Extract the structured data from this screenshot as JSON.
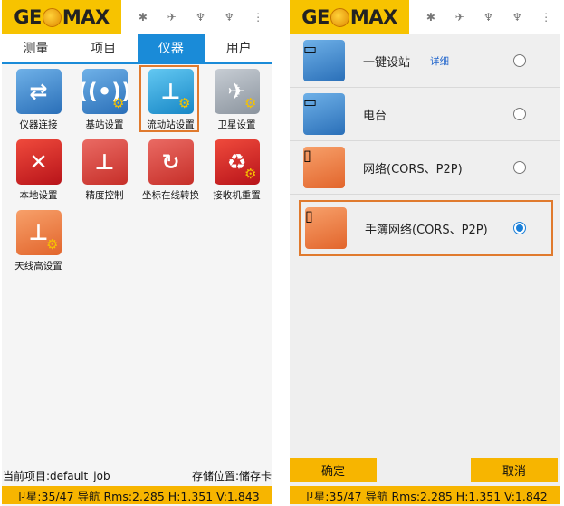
{
  "brand": {
    "logo_text_1": "GE",
    "logo_text_2": "MAX"
  },
  "status_icons": [
    "bluetooth-icon",
    "satellite-icon",
    "rover-antenna-icon",
    "radio-antenna-icon",
    "more-menu-icon"
  ],
  "left": {
    "tabs": [
      {
        "label": "测量",
        "active": false
      },
      {
        "label": "项目",
        "active": false
      },
      {
        "label": "仪器",
        "active": true
      },
      {
        "label": "用户",
        "active": false
      }
    ],
    "grid": [
      {
        "label": "仪器连接",
        "icon": "instrument-connect-icon"
      },
      {
        "label": "基站设置",
        "icon": "base-station-icon"
      },
      {
        "label": "流动站设置",
        "icon": "rover-settings-icon",
        "selected": true
      },
      {
        "label": "卫星设置",
        "icon": "satellite-settings-icon"
      },
      {
        "label": "本地设置",
        "icon": "local-settings-icon"
      },
      {
        "label": "精度控制",
        "icon": "precision-control-icon"
      },
      {
        "label": "坐标在线转换",
        "icon": "coordinate-convert-icon"
      },
      {
        "label": "接收机重置",
        "icon": "receiver-reset-icon"
      },
      {
        "label": "天线高设置",
        "icon": "antenna-height-icon"
      }
    ],
    "project": {
      "current": "当前项目:default_job",
      "storage": "存储位置:储存卡"
    },
    "status": "卫星:35/47 导航 Rms:2.285 H:1.351 V:1.843"
  },
  "right": {
    "options": [
      {
        "label": "一键设站",
        "detail": "详细",
        "icon": "router-icon",
        "checked": false
      },
      {
        "label": "电台",
        "icon": "router-icon",
        "checked": false
      },
      {
        "label": "网络(CORS、P2P)",
        "icon": "radio-handheld-icon",
        "checked": false
      },
      {
        "label": "手簿网络(CORS、P2P)",
        "icon": "radio-handheld-icon",
        "checked": true,
        "selected": true
      }
    ],
    "buttons": {
      "ok": "确定",
      "cancel": "取消"
    },
    "status": "卫星:35/47 导航 Rms:2.285 H:1.351 V:1.842"
  },
  "colors": {
    "accent": "#f7b500",
    "tab_active": "#1a8bd8",
    "highlight": "#e07a2e"
  }
}
